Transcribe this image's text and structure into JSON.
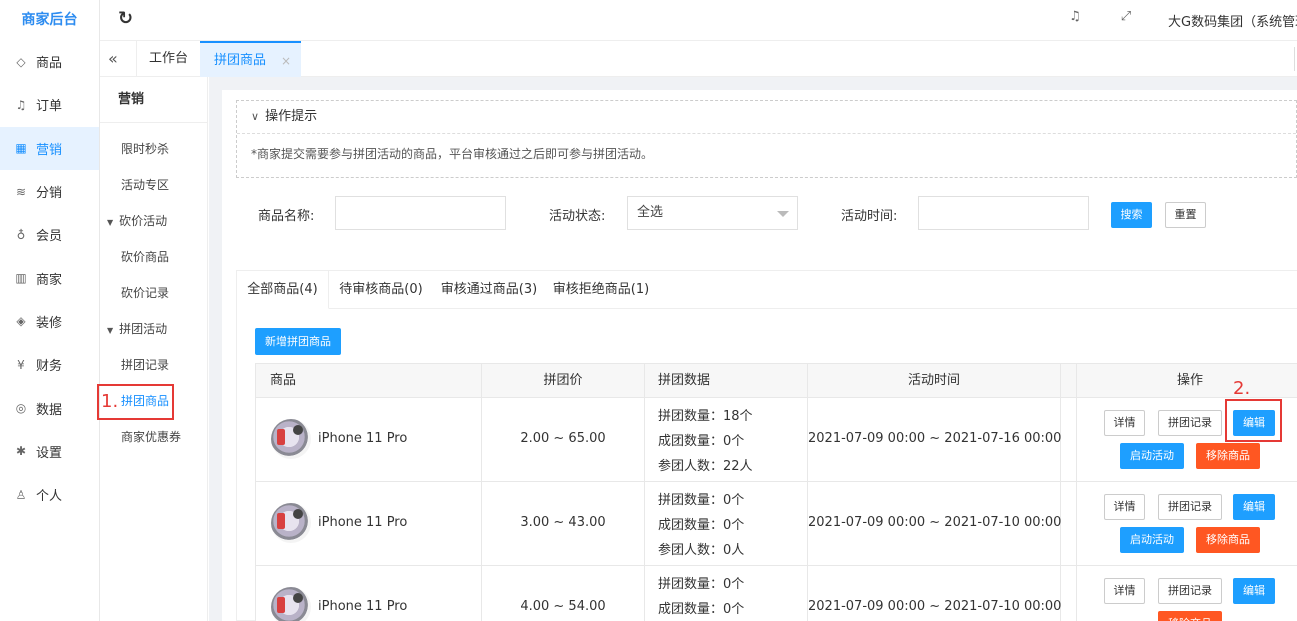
{
  "brand": "商家后台",
  "nav": [
    {
      "icon": "diamond-icon",
      "glyph": "◇",
      "label": "商品"
    },
    {
      "icon": "bell-icon",
      "glyph": "♫",
      "label": "订单"
    },
    {
      "icon": "marketing-icon",
      "glyph": "▦",
      "label": "营销"
    },
    {
      "icon": "layers-icon",
      "glyph": "≋",
      "label": "分销"
    },
    {
      "icon": "user-icon",
      "glyph": "♁",
      "label": "会员"
    },
    {
      "icon": "store-icon",
      "glyph": "▥",
      "label": "商家"
    },
    {
      "icon": "tag-icon",
      "glyph": "◈",
      "label": "装修"
    },
    {
      "icon": "yen-icon",
      "glyph": "¥",
      "label": "财务"
    },
    {
      "icon": "globe-icon",
      "glyph": "◎",
      "label": "数据"
    },
    {
      "icon": "gear-icon",
      "glyph": "✱",
      "label": "设置"
    },
    {
      "icon": "person-icon",
      "glyph": "♙",
      "label": "个人"
    }
  ],
  "nav_active_index": 2,
  "header": {
    "refresh_glyph": "↻",
    "bell_glyph": "♫",
    "fullscreen_glyph": "⤢",
    "org": "大G数码集团（系统管理"
  },
  "tabbar": {
    "collapse_glyph": "«",
    "workbench": "工作台",
    "current": "拼团商品",
    "close": "×"
  },
  "submenu": {
    "title": "营销",
    "items": [
      "限时秒杀",
      "活动专区"
    ],
    "group1": "砍价活动",
    "group1_items": [
      "砍价商品",
      "砍价记录"
    ],
    "group2": "拼团活动",
    "group2_items": [
      "拼团记录",
      "拼团商品"
    ],
    "last": "商家优惠券"
  },
  "annotations": {
    "one": "1.",
    "two": "2."
  },
  "tips": {
    "title": "操作提示",
    "text": "*商家提交需要参与拼团活动的商品，平台审核通过之后即可参与拼团活动。"
  },
  "filter": {
    "name_label": "商品名称:",
    "status_label": "活动状态:",
    "status_value": "全选",
    "time_label": "活动时间:",
    "search": "搜索",
    "reset": "重置"
  },
  "tabs": [
    "全部商品(4)",
    "待审核商品(0)",
    "审核通过商品(3)",
    "审核拒绝商品(1)"
  ],
  "add_button": "新增拼团商品",
  "columns": [
    "商品",
    "拼团价",
    "拼团数据",
    "活动时间",
    "操作"
  ],
  "rows": [
    {
      "name": "iPhone 11 Pro",
      "price": "2.00 ~ 65.00",
      "stats": [
        "拼团数量：18个",
        "成团数量：0个",
        "参团人数：22人"
      ],
      "time": "2021-07-09 00:00 ~ 2021-07-16 00:00",
      "ops": [
        "详情",
        "拼团记录",
        "编辑",
        "启动活动",
        "移除商品"
      ]
    },
    {
      "name": "iPhone 11 Pro",
      "price": "3.00 ~ 43.00",
      "stats": [
        "拼团数量：0个",
        "成团数量：0个",
        "参团人数：0人"
      ],
      "time": "2021-07-09 00:00 ~ 2021-07-10 00:00",
      "ops": [
        "详情",
        "拼团记录",
        "编辑",
        "启动活动",
        "移除商品"
      ]
    },
    {
      "name": "iPhone 11 Pro",
      "price": "4.00 ~ 54.00",
      "stats": [
        "拼团数量：0个",
        "成团数量：0个"
      ],
      "time": "2021-07-09 00:00 ~ 2021-07-10 00:00",
      "ops": [
        "详情",
        "拼团记录",
        "编辑",
        "移除商品"
      ]
    }
  ]
}
